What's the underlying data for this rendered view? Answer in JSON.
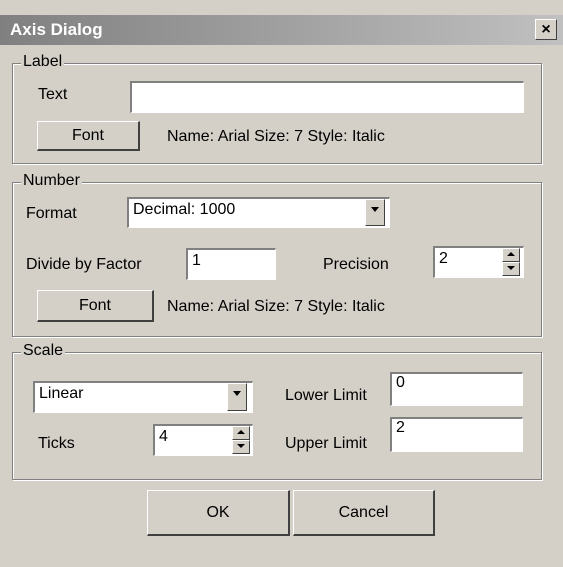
{
  "window": {
    "title": "Axis Dialog",
    "close_glyph": "×"
  },
  "label_group": {
    "legend": "Label",
    "text_label": "Text",
    "text_value": "",
    "font_button": "Font",
    "font_info": "Name: Arial Size: 7 Style: Italic"
  },
  "number_group": {
    "legend": "Number",
    "format_label": "Format",
    "format_value": "Decimal:  1000",
    "divide_label": "Divide by Factor",
    "divide_value": "1",
    "precision_label": "Precision",
    "precision_value": "2",
    "font_button": "Font",
    "font_info": "Name: Arial Size: 7 Style: Italic"
  },
  "scale_group": {
    "legend": "Scale",
    "scale_type_value": "Linear",
    "ticks_label": "Ticks",
    "ticks_value": "4",
    "lower_label": "Lower Limit",
    "lower_value": "0",
    "upper_label": "Upper Limit",
    "upper_value": "2"
  },
  "buttons": {
    "ok": "OK",
    "cancel": "Cancel"
  },
  "icons": {
    "dropdown": "chevron-down-icon",
    "spinner": "spinner-arrows-icon",
    "close": "close-icon"
  },
  "colors": {
    "face": "#d4d0c8",
    "title_start": "#808080",
    "title_end": "#c0c0c0"
  }
}
